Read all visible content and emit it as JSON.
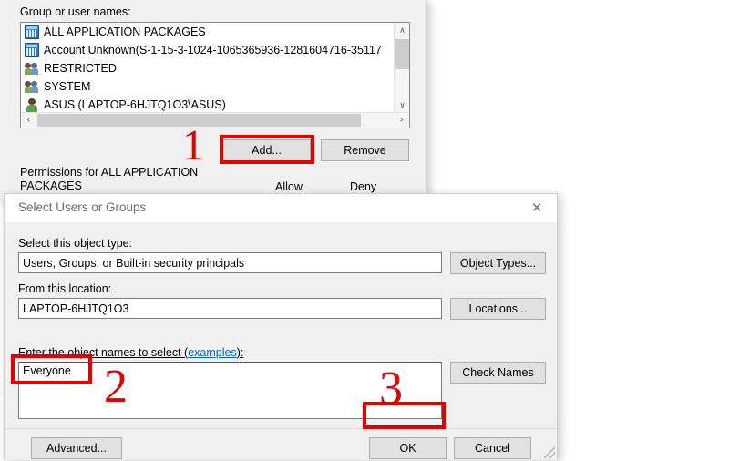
{
  "parent_window": {
    "group_label": "Group or user names:",
    "list_items": [
      {
        "icon": "app-package-icon",
        "label": "ALL APPLICATION PACKAGES"
      },
      {
        "icon": "app-package-icon",
        "label": "Account Unknown(S-1-15-3-1024-1065365936-1281604716-35117"
      },
      {
        "icon": "user-group-icon",
        "label": "RESTRICTED"
      },
      {
        "icon": "user-group-icon",
        "label": "SYSTEM"
      },
      {
        "icon": "single-user-icon",
        "label": "ASUS (LAPTOP-6HJTQ1O3\\ASUS)"
      }
    ],
    "scroll": {
      "up_glyph": "∧",
      "down_glyph": "∨",
      "left_glyph": "‹",
      "right_glyph": "›"
    },
    "add_label": "Add...",
    "remove_label": "Remove",
    "permissions_label": "Permissions for ALL APPLICATION PACKAGES",
    "allow_label": "Allow",
    "deny_label": "Deny"
  },
  "dialog": {
    "title": "Select Users or Groups",
    "close_glyph": "✕",
    "object_type_label": "Select this object type:",
    "object_type_value": "Users, Groups, or Built-in security principals",
    "object_types_button": "Object Types...",
    "location_label": "From this location:",
    "location_value": "LAPTOP-6HJTQ1O3",
    "locations_button": "Locations...",
    "object_names_label_pre": "Enter the object names to select (",
    "object_names_link": "examples",
    "object_names_label_post": "):",
    "object_names_value": "Everyone",
    "check_names_button": "Check Names",
    "advanced_button": "Advanced...",
    "ok_button": "OK",
    "cancel_button": "Cancel"
  },
  "annotations": {
    "color": "#e00000",
    "step1": "1",
    "step2": "2",
    "step3": "3"
  }
}
